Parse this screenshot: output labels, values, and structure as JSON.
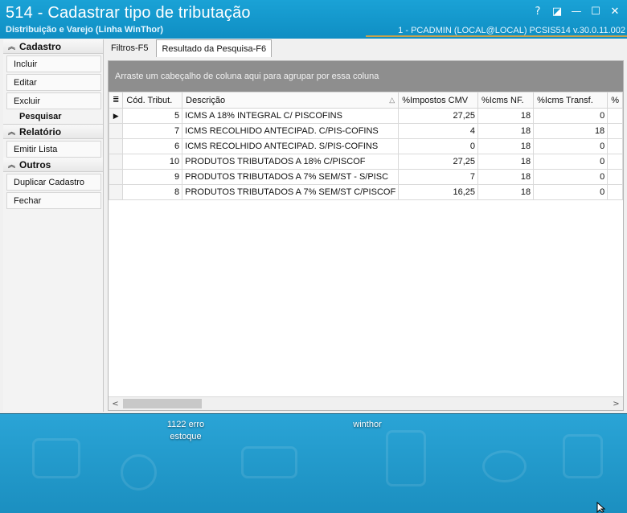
{
  "window": {
    "title": "514 - Cadastrar tipo de tributação",
    "subtitle": "Distribuição e Varejo (Linha WinThor)",
    "status_right": "1 - PCADMIN (LOCAL@LOCAL)   PCSIS514  v.30.0.11.002",
    "controls": {
      "help": "?",
      "restore_small": "◪",
      "minimize": "—",
      "maximize": "☐",
      "close": "✕"
    }
  },
  "sidebar": {
    "cadastro_header": "Cadastro",
    "cadastro_items": [
      "Incluir",
      "Editar",
      "Excluir"
    ],
    "pesquisar_label": "Pesquisar",
    "relatorio_header": "Relatório",
    "relatorio_items": [
      "Emitir Lista"
    ],
    "outros_header": "Outros",
    "outros_items": [
      "Duplicar Cadastro",
      "Fechar"
    ]
  },
  "tabs": [
    "Filtros-F5",
    "Resultado da Pesquisa-F6"
  ],
  "group_panel_text": "Arraste um cabeçalho de coluna aqui para agrupar por essa coluna",
  "grid": {
    "columns": [
      "Cód. Tribut.",
      "Descrição",
      "%Impostos CMV",
      "%Icms NF.",
      "%Icms Transf.",
      "%"
    ],
    "rows": [
      [
        "5",
        "ICMS A 18% INTEGRAL C/ PISCOFINS",
        "27,25",
        "18",
        "0"
      ],
      [
        "7",
        "ICMS RECOLHIDO ANTECIPAD. C/PIS-COFINS",
        "4",
        "18",
        "18"
      ],
      [
        "6",
        "ICMS RECOLHIDO ANTECIPAD. S/PIS-COFINS",
        "0",
        "18",
        "0"
      ],
      [
        "10",
        "PRODUTOS TRIBUTADOS A 18%  C/PISCOF",
        "27,25",
        "18",
        "0"
      ],
      [
        "9",
        "PRODUTOS TRIBUTADOS A 7% SEM/ST - S/PISC",
        "7",
        "18",
        "0"
      ],
      [
        "8",
        "PRODUTOS TRIBUTADOS A 7% SEM/ST C/PISCOF",
        "16,25",
        "18",
        "0"
      ]
    ]
  },
  "scroll": {
    "left": "<",
    "right": ">"
  },
  "desktop": {
    "icon1_line1": "1122 erro",
    "icon1_line2": "estoque",
    "icon2": "winthor"
  },
  "colors": {
    "titlebar": "#1aa2d6",
    "group_panel": "#8e8e8e"
  }
}
